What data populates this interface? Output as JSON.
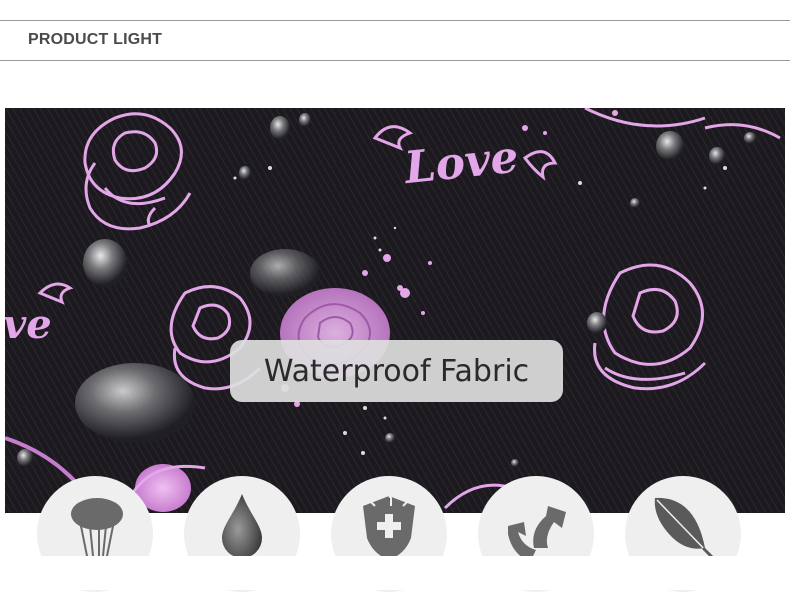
{
  "header": {
    "title": "PRODUCT LIGHT"
  },
  "hero": {
    "caption": "Waterproof Fabric",
    "decor_text_1": "Love",
    "decor_text_2": "ve",
    "accent_color": "#e3a6e8",
    "fabric_color": "#1c1a1f"
  },
  "features": [
    {
      "icon": "tassel-icon"
    },
    {
      "icon": "water-drop-icon"
    },
    {
      "icon": "shield-plus-icon"
    },
    {
      "icon": "recycle-arrows-icon"
    },
    {
      "icon": "feather-icon"
    }
  ]
}
